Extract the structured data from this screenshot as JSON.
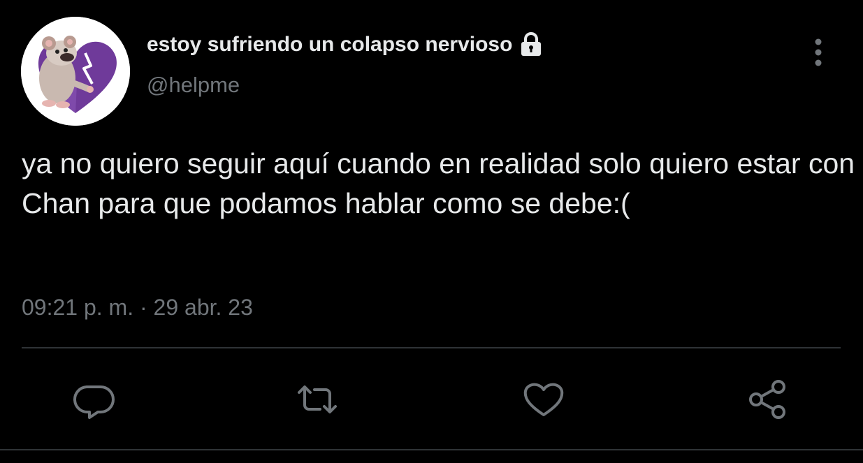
{
  "tweet": {
    "display_name": "estoy sufriendo un colapso nervioso",
    "handle": "@helpme",
    "text": "ya no quiero seguir aquí cuando en realidad solo quiero estar con Chan para que podamos hablar como se debe:(",
    "timestamp": "09:21 p. m. · 29 abr. 23",
    "protected_icon": "lock-icon",
    "avatar_icon": "avatar-broken-heart-mouse"
  },
  "actions": [
    {
      "name": "reply",
      "icon": "speech-bubble-icon"
    },
    {
      "name": "retweet",
      "icon": "retweet-arrows-icon"
    },
    {
      "name": "like",
      "icon": "heart-outline-icon"
    },
    {
      "name": "share",
      "icon": "share-nodes-icon"
    }
  ],
  "menu_icon": "vertical-ellipsis-icon",
  "colors": {
    "background": "#000000",
    "text_primary": "#e7e9ea",
    "text_secondary": "#71767b",
    "divider": "#2f3336",
    "icon": "#71767b",
    "avatar_heart": "#6f3a9a"
  }
}
